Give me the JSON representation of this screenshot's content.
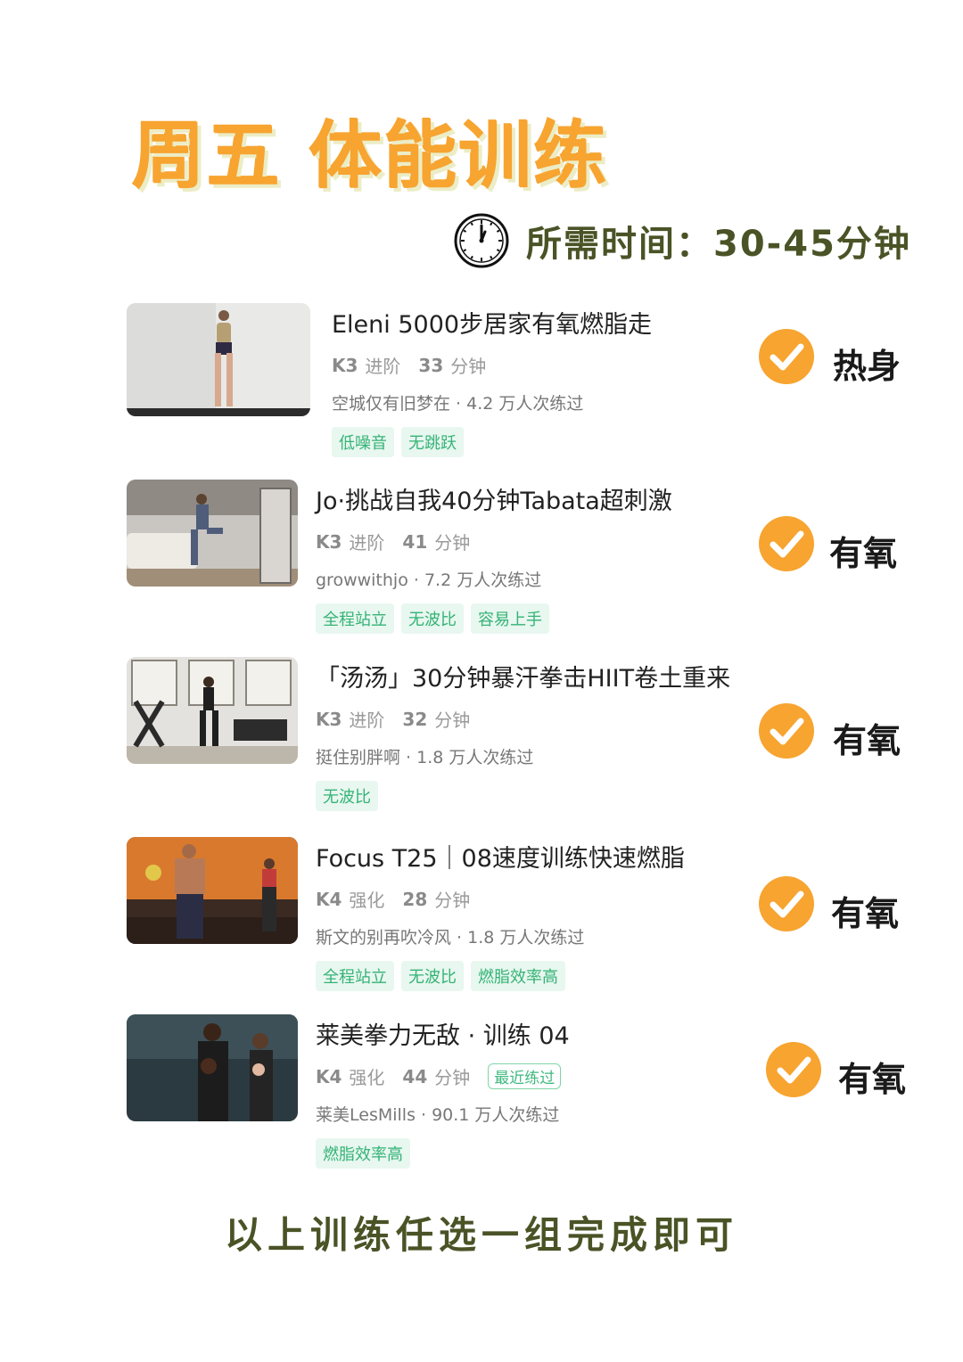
{
  "header": {
    "title": "周五 体能训练",
    "duration": "所需时间：30-45分钟"
  },
  "workouts": [
    {
      "title": "Eleni 5000步居家有氧燃脂走",
      "level": "K3",
      "level_name": "进阶",
      "minutes": "33",
      "minutes_unit": "分钟",
      "author": "空城仅有旧梦在 · 4.2 万人次练过",
      "tags": [
        "低噪音",
        "无跳跃"
      ],
      "category": "热身",
      "thumb_icon": "woman-standing-photo"
    },
    {
      "title": "Jo·挑战自我40分钟Tabata超刺激",
      "level": "K3",
      "level_name": "进阶",
      "minutes": "41",
      "minutes_unit": "分钟",
      "author": "growwithjo · 7.2 万人次练过",
      "tags": [
        "全程站立",
        "无波比",
        "容易上手"
      ],
      "category": "有氧",
      "thumb_icon": "living-room-workout-photo"
    },
    {
      "title": "「汤汤」30分钟暴汗拳击HIIT卷土重来",
      "level": "K3",
      "level_name": "进阶",
      "minutes": "32",
      "minutes_unit": "分钟",
      "author": "挺住别胖啊 · 1.8 万人次练过",
      "tags": [
        "无波比"
      ],
      "category": "有氧",
      "thumb_icon": "gym-boxing-photo"
    },
    {
      "title": "Focus T25｜08速度训练快速燃脂",
      "level": "K4",
      "level_name": "强化",
      "minutes": "28",
      "minutes_unit": "分钟",
      "author": "斯文的别再吹冷风 · 1.8 万人次练过",
      "tags": [
        "全程站立",
        "无波比",
        "燃脂效率高"
      ],
      "category": "有氧",
      "thumb_icon": "group-class-photo"
    },
    {
      "title": "莱美拳力无敌 · 训练 04",
      "level": "K4",
      "level_name": "强化",
      "minutes": "44",
      "minutes_unit": "分钟",
      "recent": "最近练过",
      "author": "莱美LesMills · 90.1 万人次练过",
      "tags": [
        "燃脂效率高"
      ],
      "category": "有氧",
      "thumb_icon": "boxing-duo-photo"
    }
  ],
  "footer": {
    "note": "以上训练任选一组完成即可"
  },
  "colors": {
    "title_orange": "#F7A430",
    "olive_text": "#4A5326",
    "tag_green": "#35B377",
    "tag_bg": "#E8F7EF",
    "check_orange": "#F7A430"
  }
}
